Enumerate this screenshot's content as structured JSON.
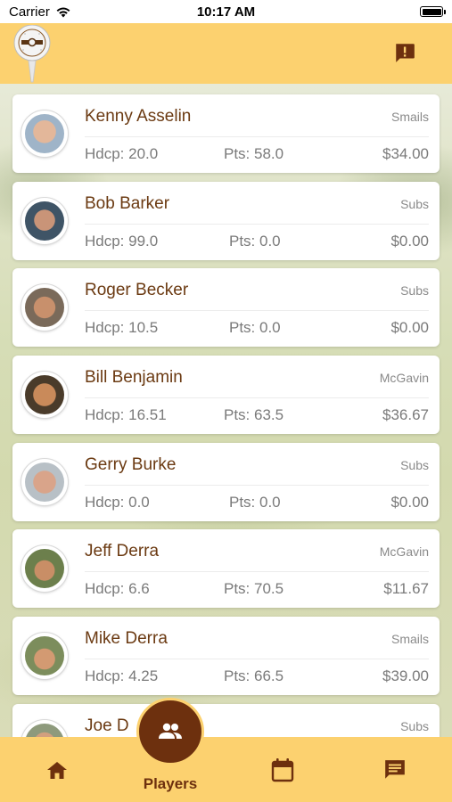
{
  "status_bar": {
    "carrier": "Carrier",
    "time": "10:17 AM",
    "signal_icon": "wifi-icon",
    "battery_icon": "battery-icon"
  },
  "header": {
    "logo_icon": "golf-ball-logo-icon",
    "alert_icon": "feedback-alert-icon",
    "background_color": "#fcd16f"
  },
  "players": [
    {
      "name": "Kenny Asselin",
      "team": "Smails",
      "hdcp": "Hdcp: 20.0",
      "pts": "Pts: 58.0",
      "money": "$34.00"
    },
    {
      "name": "Bob Barker",
      "team": "Subs",
      "hdcp": "Hdcp: 99.0",
      "pts": "Pts: 0.0",
      "money": "$0.00"
    },
    {
      "name": "Roger Becker",
      "team": "Subs",
      "hdcp": "Hdcp: 10.5",
      "pts": "Pts: 0.0",
      "money": "$0.00"
    },
    {
      "name": "Bill Benjamin",
      "team": "McGavin",
      "hdcp": "Hdcp: 16.51",
      "pts": "Pts: 63.5",
      "money": "$36.67"
    },
    {
      "name": "Gerry Burke",
      "team": "Subs",
      "hdcp": "Hdcp: 0.0",
      "pts": "Pts: 0.0",
      "money": "$0.00"
    },
    {
      "name": "Jeff Derra",
      "team": "McGavin",
      "hdcp": "Hdcp: 6.6",
      "pts": "Pts: 70.5",
      "money": "$11.67"
    },
    {
      "name": "Mike Derra",
      "team": "Smails",
      "hdcp": "Hdcp: 4.25",
      "pts": "Pts: 66.5",
      "money": "$39.00"
    },
    {
      "name": "Joe D",
      "team": "Subs",
      "hdcp": "",
      "pts": "",
      "money": ""
    }
  ],
  "tab_bar": {
    "tabs": [
      {
        "name": "home",
        "icon": "home-icon",
        "label": ""
      },
      {
        "name": "players",
        "icon": "people-icon",
        "label": "Players",
        "active": true
      },
      {
        "name": "calendar",
        "icon": "calendar-icon",
        "label": ""
      },
      {
        "name": "messages",
        "icon": "chat-icon",
        "label": ""
      }
    ],
    "active_color": "#6d300e"
  },
  "colors": {
    "accent": "#fcd16f",
    "brand_brown": "#6d300e",
    "name_text": "#6b3a12"
  }
}
